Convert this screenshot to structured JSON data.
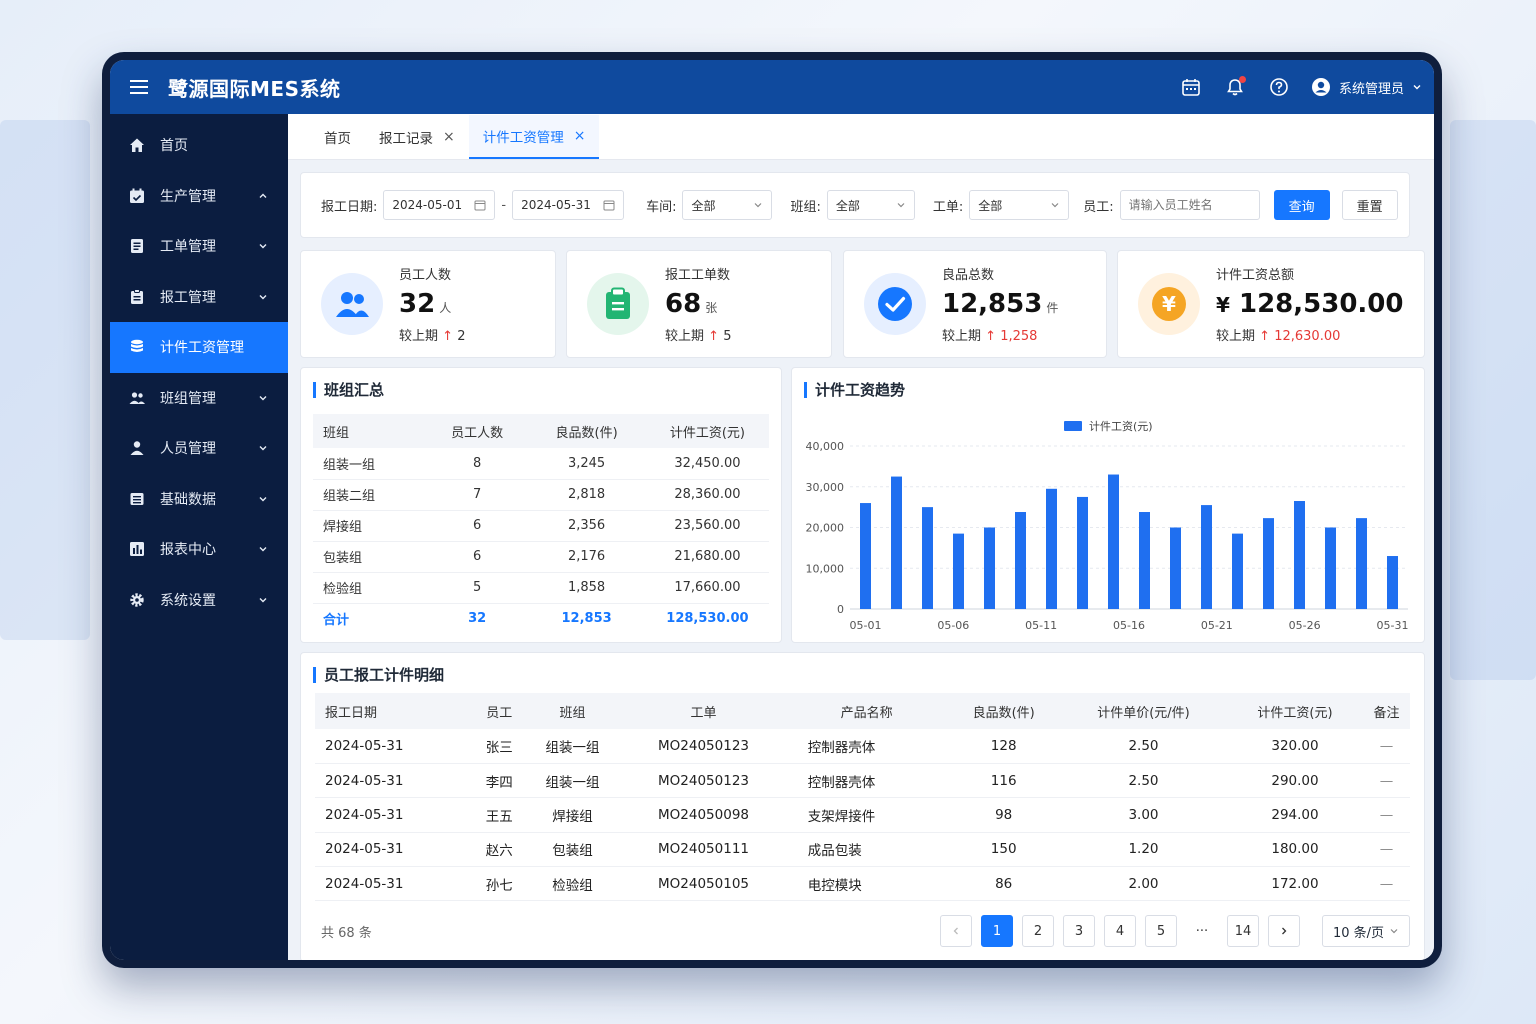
{
  "header": {
    "title": "鹭源国际MES系统",
    "user": "系统管理员"
  },
  "sidebar": {
    "items": [
      {
        "label": "首页"
      },
      {
        "label": "生产管理"
      },
      {
        "label": "工单管理"
      },
      {
        "label": "报工管理"
      },
      {
        "label": "计件工资管理"
      },
      {
        "label": "班组管理"
      },
      {
        "label": "人员管理"
      },
      {
        "label": "基础数据"
      },
      {
        "label": "报表中心"
      },
      {
        "label": "系统设置"
      }
    ]
  },
  "tabs": [
    {
      "label": "首页"
    },
    {
      "label": "报工记录",
      "close": "×"
    },
    {
      "label": "计件工资管理",
      "close": "×"
    }
  ],
  "filters": {
    "date_label": "报工日期:",
    "date_start": "2024-05-01",
    "date_sep": "-",
    "date_end": "2024-05-31",
    "workshop_label": "车间:",
    "workshop_value": "全部",
    "team_label": "班组:",
    "team_value": "全部",
    "order_label": "工单:",
    "order_value": "全部",
    "employee_label": "员工:",
    "employee_placeholder": "请输入员工姓名",
    "query_button": "查询",
    "reset_button": "重置"
  },
  "stats": [
    {
      "label": "员工人数",
      "value": "32",
      "unit": "人",
      "cmp_label": "较上期",
      "cmp_value": "2",
      "color": "#1677ff",
      "bg": "#e6efff"
    },
    {
      "label": "报工工单数",
      "value": "68",
      "unit": "张",
      "cmp_label": "较上期",
      "cmp_value": "5",
      "color": "#22b573",
      "bg": "#e4f6ec"
    },
    {
      "label": "良品总数",
      "value": "12,853",
      "unit": "件",
      "cmp_label": "较上期",
      "cmp_value": "1,258",
      "color": "#1677ff",
      "bg": "#e6efff"
    },
    {
      "label": "计件工资总额",
      "value": "128,530.00",
      "prefix": "¥",
      "cmp_label": "较上期",
      "cmp_value": "12,630.00",
      "color": "#f59e0b",
      "bg": "#fff1de"
    }
  ],
  "team_summary": {
    "title": "班组汇总",
    "columns": [
      "班组",
      "员工人数",
      "良品数(件)",
      "计件工资(元)"
    ],
    "rows": [
      [
        "组装一组",
        "8",
        "3,245",
        "32,450.00"
      ],
      [
        "组装二组",
        "7",
        "2,818",
        "28,360.00"
      ],
      [
        "焊接组",
        "6",
        "2,356",
        "23,560.00"
      ],
      [
        "包装组",
        "6",
        "2,176",
        "21,680.00"
      ],
      [
        "检验组",
        "5",
        "1,858",
        "17,660.00"
      ]
    ],
    "total": [
      "合计",
      "32",
      "12,853",
      "128,530.00"
    ]
  },
  "chart_title": "计件工资趋势",
  "chart_data": {
    "type": "bar",
    "series": [
      {
        "name": "计件工资(元)",
        "values": [
          26000,
          32500,
          25000,
          18500,
          20000,
          23800,
          29500,
          27500,
          33000,
          23800,
          20000,
          25500,
          18500,
          22300,
          26500,
          20000,
          22300,
          13000
        ]
      }
    ],
    "x_tick_labels": [
      "05-01",
      "05-06",
      "05-11",
      "05-16",
      "05-21",
      "05-26",
      "05-31"
    ],
    "y_ticks": [
      "0",
      "10,000",
      "20,000",
      "30,000",
      "40,000"
    ],
    "ylim": [
      0,
      40000
    ],
    "color": "#1f6ff0",
    "grid": true,
    "legend": "top-center"
  },
  "detail": {
    "title": "员工报工计件明细",
    "columns": [
      "报工日期",
      "员工",
      "班组",
      "工单",
      "产品名称",
      "良品数(件)",
      "计件单价(元/件)",
      "计件工资(元)",
      "备注"
    ],
    "rows": [
      [
        "2024-05-31",
        "张三",
        "组装一组",
        "MO24050123",
        "控制器壳体",
        "128",
        "2.50",
        "320.00",
        "—"
      ],
      [
        "2024-05-31",
        "李四",
        "组装一组",
        "MO24050123",
        "控制器壳体",
        "116",
        "2.50",
        "290.00",
        "—"
      ],
      [
        "2024-05-31",
        "王五",
        "焊接组",
        "MO24050098",
        "支架焊接件",
        "98",
        "3.00",
        "294.00",
        "—"
      ],
      [
        "2024-05-31",
        "赵六",
        "包装组",
        "MO24050111",
        "成品包装",
        "150",
        "1.20",
        "180.00",
        "—"
      ],
      [
        "2024-05-31",
        "孙七",
        "检验组",
        "MO24050105",
        "电控模块",
        "86",
        "2.00",
        "172.00",
        "—"
      ]
    ],
    "total_text": "共 68 条",
    "pages": [
      "1",
      "2",
      "3",
      "4",
      "5",
      "···",
      "14"
    ],
    "page_size": "10 条/页"
  }
}
